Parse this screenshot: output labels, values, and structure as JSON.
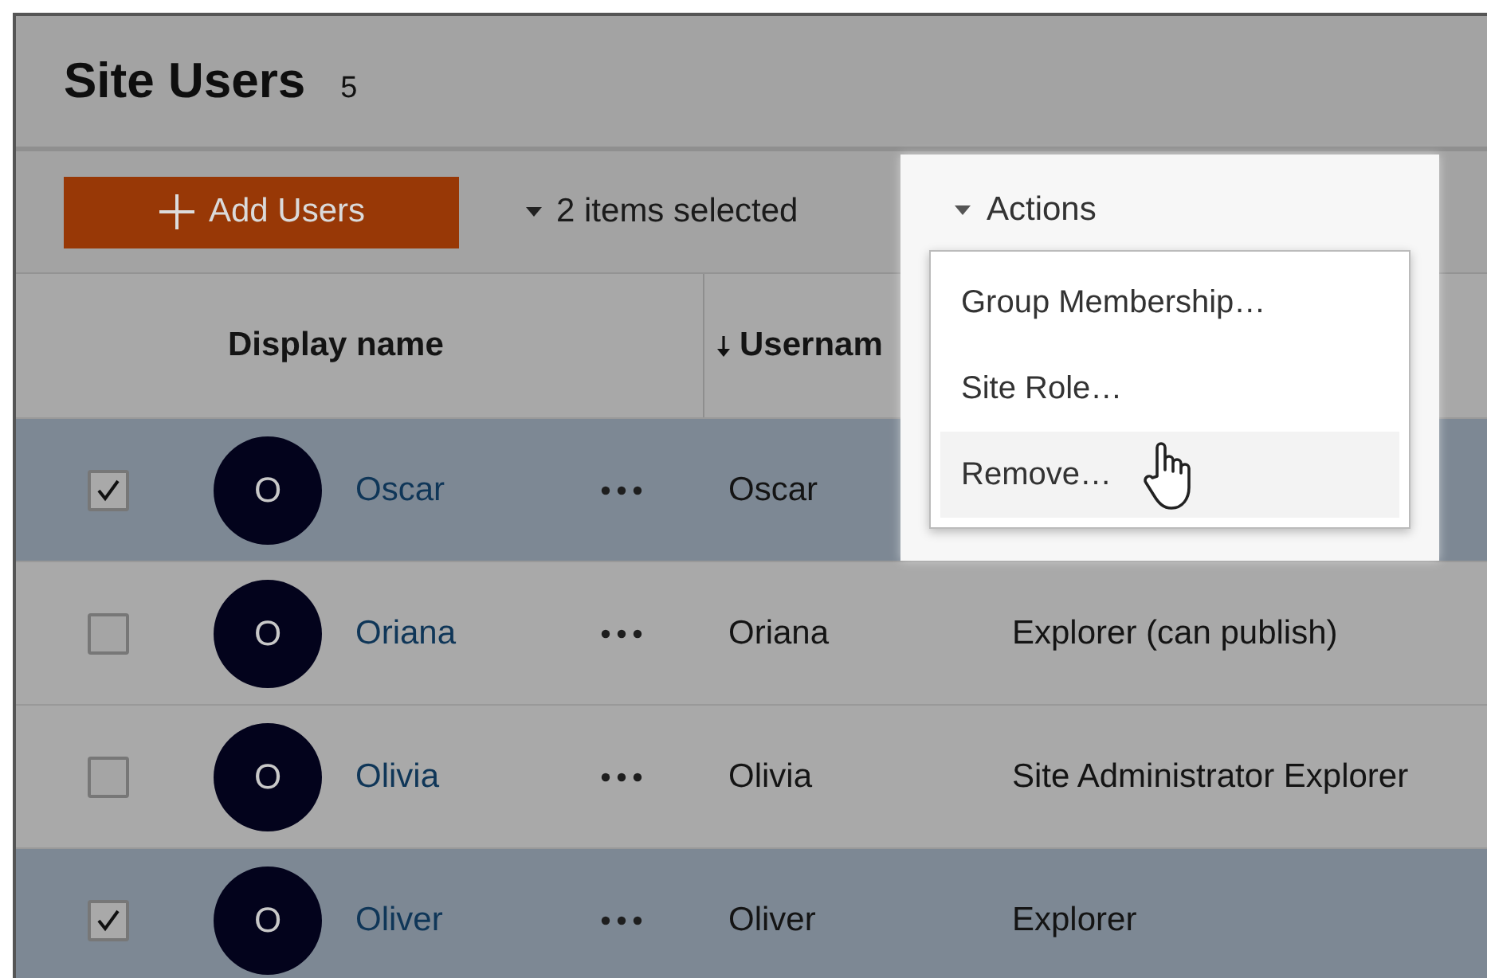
{
  "header": {
    "title": "Site Users",
    "count": "5"
  },
  "toolbar": {
    "add_button": "Add Users",
    "selection": "2 items selected",
    "actions": "Actions"
  },
  "menu": {
    "items": [
      {
        "label": "Group Membership…",
        "highlighted": false
      },
      {
        "label": "Site Role…",
        "highlighted": false
      },
      {
        "label": "Remove…",
        "highlighted": true
      }
    ]
  },
  "columns": [
    {
      "label": "Display name",
      "sorted": false
    },
    {
      "label": "Usernam",
      "sorted": true
    }
  ],
  "rows": [
    {
      "selected": true,
      "initial": "O",
      "display_name": "Oscar",
      "username": "Oscar"
    },
    {
      "selected": false,
      "initial": "O",
      "display_name": "Oriana",
      "username": "Oriana",
      "site_role": "Explorer (can publish)"
    },
    {
      "selected": false,
      "initial": "O",
      "display_name": "Olivia",
      "username": "Olivia",
      "site_role": "Site Administrator Explorer"
    },
    {
      "selected": true,
      "initial": "O",
      "display_name": "Oliver",
      "username": "Oliver",
      "site_role": "Explorer"
    }
  ]
}
